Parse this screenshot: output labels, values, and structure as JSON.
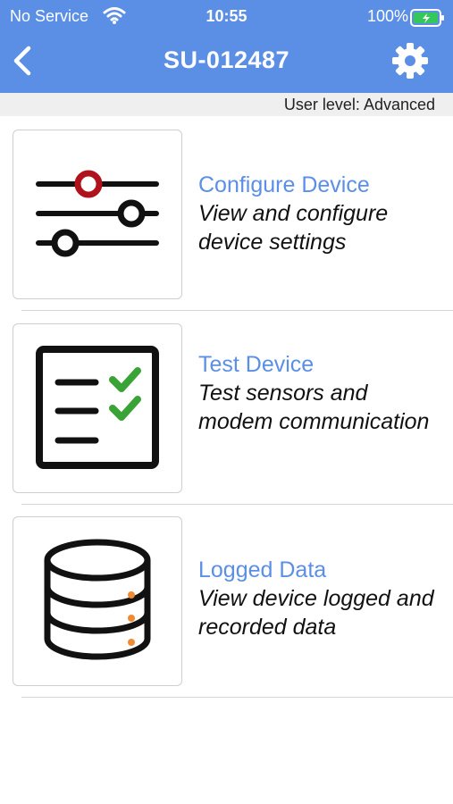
{
  "status_bar": {
    "carrier": "No Service",
    "time": "10:55",
    "battery": "100%"
  },
  "nav": {
    "title": "SU-012487"
  },
  "user_level": "User level: Advanced",
  "menu": [
    {
      "label": "Configure Device",
      "description": "View and configure device settings",
      "icon": "sliders-icon"
    },
    {
      "label": "Test Device",
      "description": "Test sensors and modem communication",
      "icon": "checklist-icon"
    },
    {
      "label": "Logged Data",
      "description": "View device logged and recorded data",
      "icon": "database-icon"
    }
  ],
  "colors": {
    "accent": "#5b8fe6",
    "check_green": "#3aa335",
    "slider_red": "#b0121b",
    "db_orange": "#f08a33",
    "battery_green": "#34c759"
  }
}
